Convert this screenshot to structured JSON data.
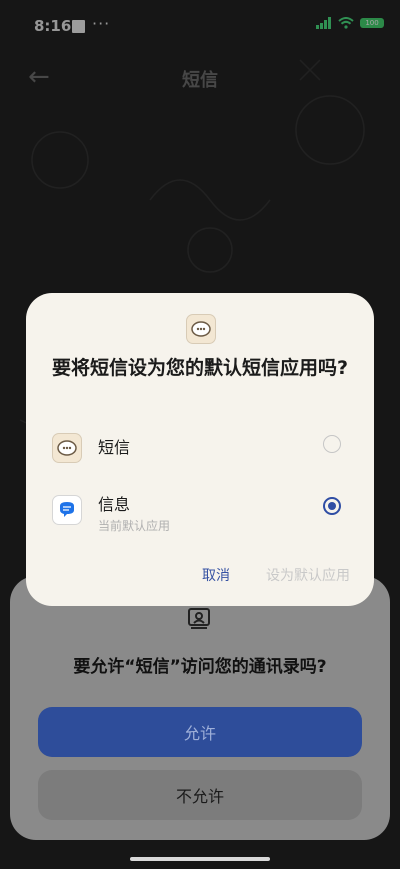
{
  "status_bar": {
    "time": "8:16",
    "dots": "···",
    "battery": "100"
  },
  "app_bar": {
    "back_icon": "back-arrow-icon",
    "title": "短信"
  },
  "permission_sheet": {
    "icon": "contacts-card-icon",
    "title": "要允许“短信”访问您的通讯录吗?",
    "allow_label": "允许",
    "deny_label": "不允许"
  },
  "dialog": {
    "title": "要将短信设为您的默认短信应用吗?",
    "options": [
      {
        "label": "短信",
        "subtitle": "",
        "selected": false,
        "icon": "sms-app-icon"
      },
      {
        "label": "信息",
        "subtitle": "当前默认应用",
        "selected": true,
        "icon": "messages-app-icon"
      }
    ],
    "cancel_label": "取消",
    "set_default_label": "设为默认应用"
  },
  "colors": {
    "accent": "#2f4da4",
    "dialog_bg": "#f6f3ec",
    "background": "#222222"
  }
}
